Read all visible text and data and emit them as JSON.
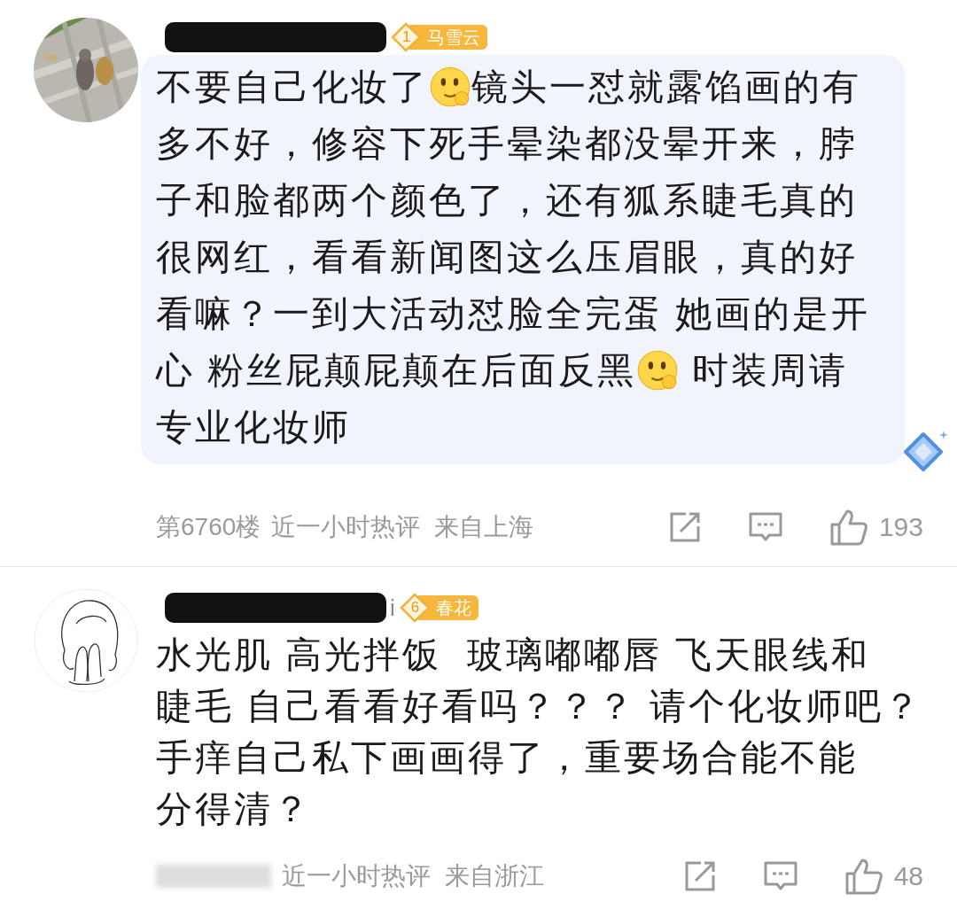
{
  "comments": [
    {
      "avatar": {
        "kind": "picture"
      },
      "name": {
        "redacted": true
      },
      "badge": {
        "level": "1",
        "text": "马雪云"
      },
      "highlighted": true,
      "body_lines": [
        [
          {
            "kind": "text",
            "text": "不要自己化妆了"
          },
          {
            "kind": "emoji"
          },
          {
            "kind": "text",
            "text": "镜头一怼就露馅画的有"
          }
        ],
        [
          {
            "kind": "text",
            "text": "多不好，修容下死手晕染都没晕开来，脖"
          }
        ],
        [
          {
            "kind": "text",
            "text": "子和脸都两个颜色了，还有狐系睫毛真的"
          }
        ],
        [
          {
            "kind": "text",
            "text": "很网红，看看新闻图这么压眉眼，真的好"
          }
        ],
        [
          {
            "kind": "text",
            "text": "看嘛？一到大活动怼脸全完蛋 她画的是开"
          }
        ],
        [
          {
            "kind": "text",
            "text": "心 粉丝屁颠屁颠在后面反黑"
          },
          {
            "kind": "emoji"
          },
          {
            "kind": "text",
            "text": " 时装周请"
          }
        ],
        [
          {
            "kind": "text",
            "text": "专业化妆师"
          }
        ]
      ],
      "floor": "第6760楼",
      "floor_blurred": false,
      "time": "近一小时热评",
      "location": "来自上海",
      "likes": "193"
    },
    {
      "avatar": {
        "kind": "drawing"
      },
      "name": {
        "redacted": true,
        "visible_text": "i"
      },
      "badge": {
        "level": "6",
        "text": "春花"
      },
      "highlighted": false,
      "body_lines": [
        [
          {
            "kind": "text",
            "text": "水光肌 高光拌饭  玻璃嘟嘟唇 飞天眼线和"
          }
        ],
        [
          {
            "kind": "text",
            "text": "睫毛 自己看看好看吗？？？ 请个化妆师吧？"
          }
        ],
        [
          {
            "kind": "text",
            "text": "手痒自己私下画画得了，重要场合能不能"
          }
        ],
        [
          {
            "kind": "text",
            "text": "分得清？"
          }
        ]
      ],
      "floor_blurred": true,
      "time": "近一小时热评",
      "location": "来自浙江",
      "likes": "48"
    }
  ]
}
